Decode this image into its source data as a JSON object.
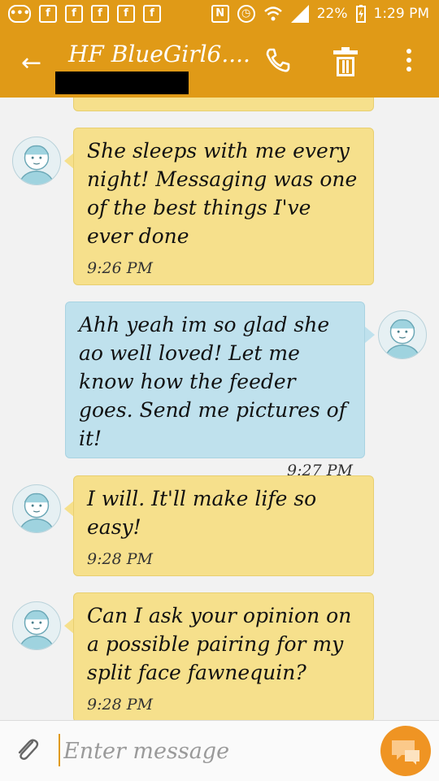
{
  "status_bar": {
    "battery": "22%",
    "time": "1:29 PM",
    "icons": [
      "message-icon",
      "facebook-icon",
      "facebook-icon",
      "facebook-icon",
      "facebook-icon",
      "facebook-icon",
      "nfc-icon",
      "alarm-icon",
      "wifi-icon",
      "signal-icon",
      "battery-charging-icon"
    ]
  },
  "header": {
    "title": "HF BlueGirl6....",
    "back_icon": "back-arrow-icon",
    "call_icon": "phone-icon",
    "delete_icon": "trash-icon",
    "more_icon": "more-vert-icon",
    "accent": "#e09a17"
  },
  "messages": [
    {
      "direction": "in",
      "text": "She sleeps with me every night! Messaging was one of the best things I've ever done",
      "time": "9:26 PM"
    },
    {
      "direction": "out",
      "text": "Ahh yeah im so glad she ao well loved! Let me know how the feeder goes. Send me pictures of it!",
      "time": "9:27 PM"
    },
    {
      "direction": "in",
      "text": "I will. It'll make life so easy!",
      "time": "9:28 PM"
    },
    {
      "direction": "in",
      "text": "Can I ask your opinion on a possible pairing for my split face fawnequin?",
      "time": "9:28 PM"
    }
  ],
  "colors": {
    "incoming_bubble": "#f6e08c",
    "outgoing_bubble": "#bfe1ed",
    "send_button": "#ef9423"
  },
  "composer": {
    "placeholder": "Enter message",
    "value": ""
  }
}
